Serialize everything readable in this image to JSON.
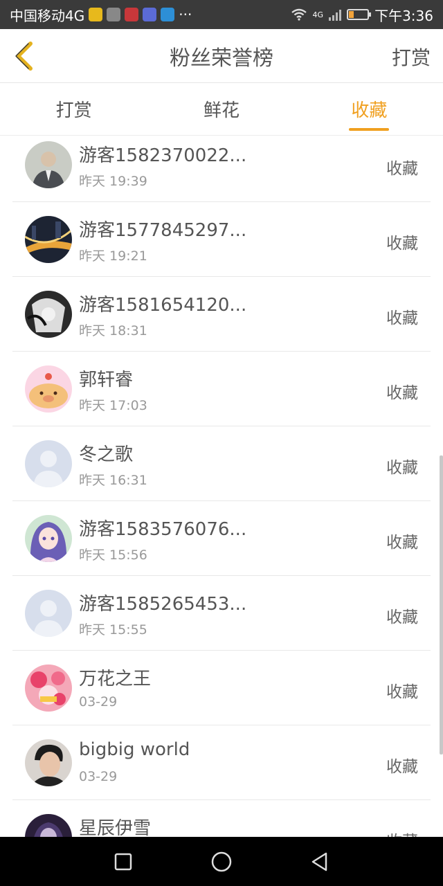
{
  "status_bar": {
    "carrier": "中国移动4G",
    "more": "···",
    "network_label": "4G",
    "time": "下午3:36",
    "battery_level": 0.25
  },
  "header": {
    "title": "粉丝荣誉榜",
    "action_label": "打赏"
  },
  "tabs": [
    {
      "label": "打赏",
      "active": false
    },
    {
      "label": "鲜花",
      "active": false
    },
    {
      "label": "收藏",
      "active": true
    }
  ],
  "fans": [
    {
      "name": "游客1582370022...",
      "time": "昨天 19:39",
      "tag": "收藏",
      "avatar": "photo-man-icon"
    },
    {
      "name": "游客1577845297...",
      "time": "昨天 19:21",
      "tag": "收藏",
      "avatar": "city-night-icon"
    },
    {
      "name": "游客1581654120...",
      "time": "昨天 18:31",
      "tag": "收藏",
      "avatar": "anime-bw-icon"
    },
    {
      "name": "郭轩睿",
      "time": "昨天 17:03",
      "tag": "收藏",
      "avatar": "cartoon-pig-icon"
    },
    {
      "name": "冬之歌",
      "time": "昨天 16:31",
      "tag": "收藏",
      "avatar": "default-user-icon"
    },
    {
      "name": "游客1583576076...",
      "time": "昨天 15:56",
      "tag": "收藏",
      "avatar": "anime-girl-icon"
    },
    {
      "name": "游客1585265453...",
      "time": "昨天 15:55",
      "tag": "收藏",
      "avatar": "default-user-icon"
    },
    {
      "name": "万花之王",
      "time": "03-29",
      "tag": "收藏",
      "avatar": "flower-pink-icon"
    },
    {
      "name": "bigbig world",
      "time": "03-29",
      "tag": "收藏",
      "avatar": "photo-boy-icon"
    },
    {
      "name": "星辰伊雪",
      "time": "",
      "tag": "收藏",
      "avatar": "anime-dark-icon"
    }
  ],
  "colors": {
    "accent": "#f0a020",
    "status_bar": "#3a3a3a",
    "nav_bar": "#000000",
    "text": "#555555",
    "subtext": "#999999"
  }
}
